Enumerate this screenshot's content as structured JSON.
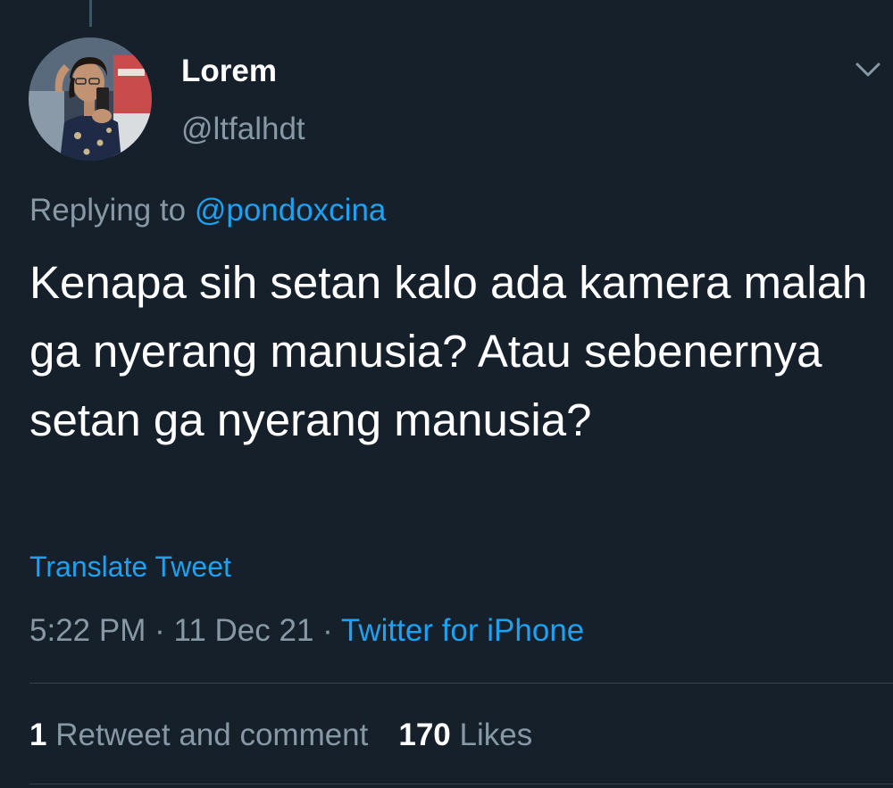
{
  "tweet": {
    "display_name": "Lorem",
    "handle": "@ltfalhdt",
    "replying_prefix": "Replying to ",
    "replying_to": "@pondoxcina",
    "text": "Kenapa sih setan kalo ada kamera malah ga nyerang manusia? Atau sebenernya setan ga nyerang manusia?",
    "translate_label": "Translate Tweet",
    "time": "5:22 PM",
    "separator": " · ",
    "date": "11 Dec 21",
    "source": "Twitter for iPhone"
  },
  "stats": {
    "retweets_count": "1",
    "retweets_label": "Retweet and comment",
    "likes_count": "170",
    "likes_label": "Likes"
  },
  "icons": {
    "caret": "chevron-down-icon",
    "avatar": "avatar"
  },
  "colors": {
    "background": "#15202b",
    "text_primary": "#ffffff",
    "text_secondary": "#8899a6",
    "accent": "#1da1f2",
    "divider": "#38444d"
  }
}
